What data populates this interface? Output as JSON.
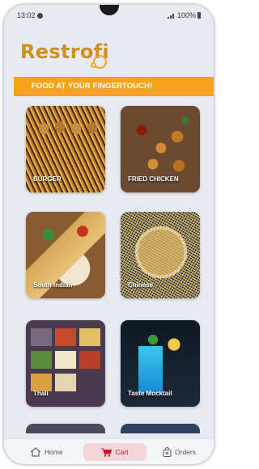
{
  "status_bar": {
    "time": "13:02",
    "battery": "100%"
  },
  "app": {
    "logo_text_main": "Restro",
    "logo_text_accent": "fi"
  },
  "banner": {
    "text": "FOOD AT YOUR FINGERTOUCH!"
  },
  "categories": [
    {
      "label": "BURGER"
    },
    {
      "label": "FRIED CHICKEN"
    },
    {
      "label": "South Indian"
    },
    {
      "label": "Chinese"
    },
    {
      "label": "Thali"
    },
    {
      "label": "Taste Mocktail"
    }
  ],
  "bottom_nav": {
    "home": "Home",
    "cart": "Cart",
    "orders": "Orders",
    "active": "cart"
  },
  "colors": {
    "brand": "#d0901a",
    "banner": "#f5a21c",
    "cart_active": "#c0152d"
  }
}
